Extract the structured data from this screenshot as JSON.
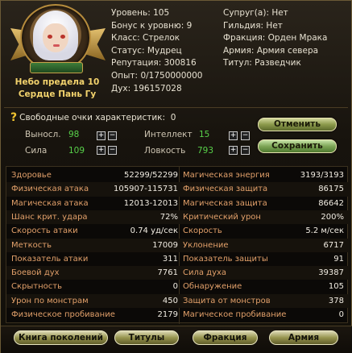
{
  "character": {
    "name_line1": "Небо предела 10",
    "name_line2": "Сердце Пань Гу"
  },
  "info_mid": [
    {
      "label": "Уровень",
      "value": "105"
    },
    {
      "label": "Бонус к уровню",
      "value": "9"
    },
    {
      "label": "Класс",
      "value": "Стрелок"
    },
    {
      "label": "Статус",
      "value": "Мудрец"
    },
    {
      "label": "Репутация",
      "value": "300816"
    },
    {
      "label": "Опыт",
      "value": "0/1750000000"
    },
    {
      "label": "Дух",
      "value": "196157028"
    }
  ],
  "info_right": [
    {
      "label": "Супруг(а)",
      "value": "Нет"
    },
    {
      "label": "Гильдия",
      "value": "Нет"
    },
    {
      "label": "Фракция",
      "value": "Орден Мрака"
    },
    {
      "label": "Армия",
      "value": "Армия севера"
    },
    {
      "label": "Титул",
      "value": "Разведчик"
    }
  ],
  "free_points": {
    "label": "Свободные очки характеристик",
    "value": "0"
  },
  "attributes": {
    "stamina": {
      "label": "Выносл.",
      "value": "98"
    },
    "strength": {
      "label": "Сила",
      "value": "109"
    },
    "intellect": {
      "label": "Интеллект",
      "value": "15"
    },
    "agility": {
      "label": "Ловкость",
      "value": "793"
    }
  },
  "buttons": {
    "cancel": "Отменить",
    "save": "Сохранить"
  },
  "stats": [
    {
      "l1": "Здоровье",
      "v1": "52299/52299",
      "l2": "Магическая энергия",
      "v2": "3193/3193"
    },
    {
      "l1": "Физическая атака",
      "v1": "105907-115731",
      "l2": "Физическая защита",
      "v2": "86175"
    },
    {
      "l1": "Магическая атака",
      "v1": "12013-12013",
      "l2": "Магическая защита",
      "v2": "86642"
    },
    {
      "l1": "Шанс крит. удара",
      "v1": "72%",
      "l2": "Критический урон",
      "v2": "200%"
    },
    {
      "l1": "Скорость атаки",
      "v1": "0.74 уд/сек",
      "l2": "Скорость",
      "v2": "5.2 м/сек"
    },
    {
      "l1": "Меткость",
      "v1": "17009",
      "l2": "Уклонение",
      "v2": "6717"
    },
    {
      "l1": "Показатель атаки",
      "v1": "311",
      "l2": "Показатель защиты",
      "v2": "91"
    },
    {
      "l1": "Боевой дух",
      "v1": "7761",
      "l2": "Сила духа",
      "v2": "39387"
    },
    {
      "l1": "Скрытность",
      "v1": "0",
      "l2": "Обнаружение",
      "v2": "105"
    },
    {
      "l1": "Урон по монстрам",
      "v1": "450",
      "l2": "Защита от монстров",
      "v2": "378"
    },
    {
      "l1": "Физическое пробивание",
      "v1": "2179",
      "l2": "Магическое пробивание",
      "v2": "0"
    }
  ],
  "tabs": [
    "Книга поколений",
    "Титулы",
    "Фракция",
    "Армия"
  ],
  "icons": {
    "help": "question-mark-icon",
    "plus": "plus-icon",
    "minus": "minus-icon"
  },
  "colors": {
    "label_orange": "#e2a06a",
    "value_green": "#58d14a",
    "name_gold": "#f3d36d",
    "help_yellow": "#f2c531"
  }
}
